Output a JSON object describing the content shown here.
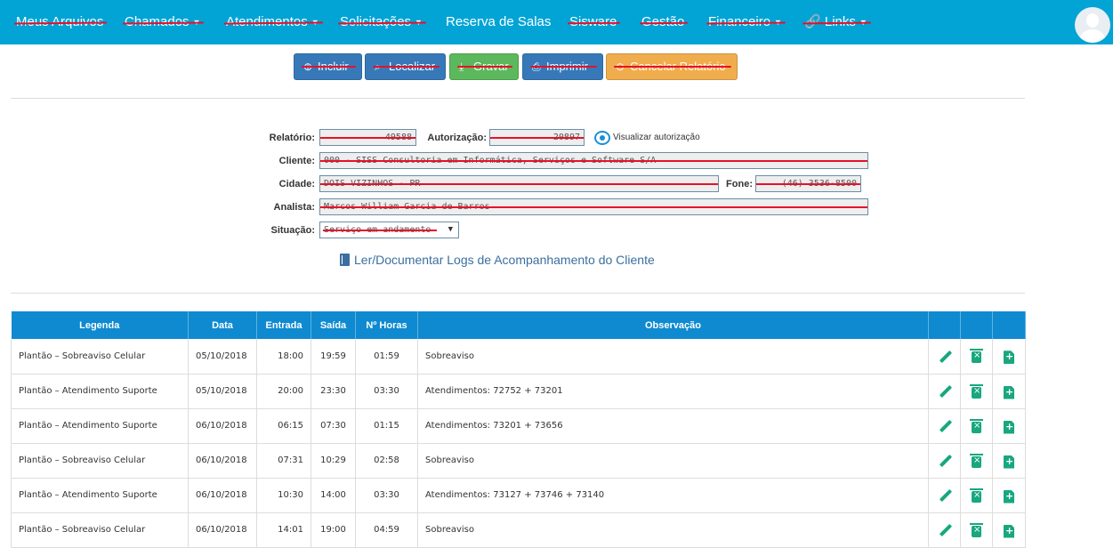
{
  "navbar": {
    "items": [
      {
        "label": "Meus Arquivos",
        "caret": ""
      },
      {
        "label": "Chamados",
        "caret": "▼"
      },
      {
        "label": "Atendimentos",
        "caret": "▼"
      },
      {
        "label": "Solicitações",
        "caret": "▼"
      },
      {
        "label": "Reserva de Salas",
        "caret": ""
      },
      {
        "label": "Sisware",
        "caret": ""
      },
      {
        "label": "Gestão",
        "caret": ""
      },
      {
        "label": "Financeiro",
        "caret": "▼"
      },
      {
        "label": "Links",
        "caret": "▼"
      }
    ],
    "accent": "#02a4d6"
  },
  "toolbar": {
    "incluir": "Incluir",
    "localizar": "Localizar",
    "gravar": "Gravar",
    "imprimir": "Imprimir",
    "cancelar": "Cancelar Relatório"
  },
  "form": {
    "relatorio_label": "Relatório:",
    "relatorio_value": "49588",
    "autorizacao_label": "Autorização:",
    "autorizacao_value": "20897",
    "visualizar": "Visualizar autorização",
    "cliente_label": "Cliente:",
    "cliente_value": "000 - SISS Consultoria em Informática, Serviços e Software S/A",
    "cidade_label": "Cidade:",
    "cidade_value": "DOIS VIZINHOS - PR",
    "fone_label": "Fone:",
    "fone_value": "(46) 3536-8500",
    "analista_label": "Analista:",
    "analista_value": "Marcos William Garcia de Barros",
    "situacao_label": "Situação:",
    "situacao_value": "Serviço em andamento",
    "logs_link": "Ler/Documentar Logs de Acompanhamento do Cliente"
  },
  "table": {
    "headers": [
      "Legenda",
      "Data",
      "Entrada",
      "Saída",
      "Nº Horas",
      "Observação",
      "",
      "",
      ""
    ],
    "rows": [
      {
        "legenda": "Plantão – Sobreaviso Celular",
        "data": "05/10/2018",
        "entrada": "18:00",
        "saida": "19:59",
        "horas": "01:59",
        "obs": "Sobreaviso"
      },
      {
        "legenda": "Plantão – Atendimento Suporte",
        "data": "05/10/2018",
        "entrada": "20:00",
        "saida": "23:30",
        "horas": "03:30",
        "obs": "Atendimentos: 72752 + 73201"
      },
      {
        "legenda": "Plantão – Atendimento Suporte",
        "data": "06/10/2018",
        "entrada": "06:15",
        "saida": "07:30",
        "horas": "01:15",
        "obs": "Atendimentos: 73201 + 73656"
      },
      {
        "legenda": "Plantão – Sobreaviso Celular",
        "data": "06/10/2018",
        "entrada": "07:31",
        "saida": "10:29",
        "horas": "02:58",
        "obs": "Sobreaviso"
      },
      {
        "legenda": "Plantão – Atendimento Suporte",
        "data": "06/10/2018",
        "entrada": "10:30",
        "saida": "14:00",
        "horas": "03:30",
        "obs": "Atendimentos: 73127 + 73746 + 73140"
      },
      {
        "legenda": "Plantão – Sobreaviso Celular",
        "data": "06/10/2018",
        "entrada": "14:01",
        "saida": "19:00",
        "horas": "04:59",
        "obs": "Sobreaviso"
      }
    ]
  }
}
